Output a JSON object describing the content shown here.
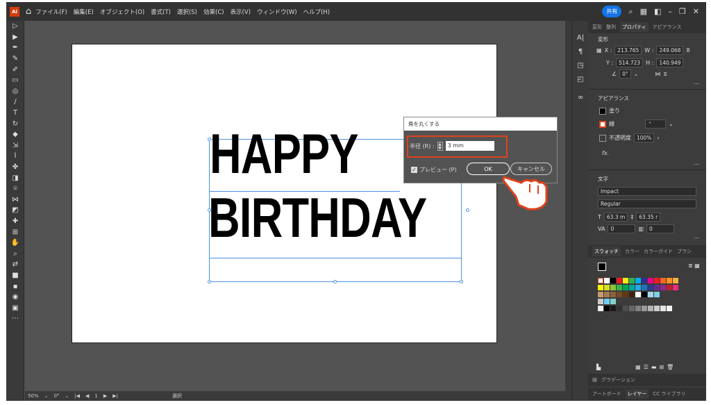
{
  "menubar": {
    "logo": "Ai",
    "items": [
      "ファイル(F)",
      "編集(E)",
      "オブジェクト(O)",
      "書式(T)",
      "選択(S)",
      "効果(C)",
      "表示(V)",
      "ウィンドウ(W)",
      "ヘルプ(H)"
    ],
    "share": "共有"
  },
  "artboard": {
    "line1": "HAPPY",
    "line2": "BIRTHDAY"
  },
  "dialog": {
    "title": "角を丸くする",
    "radius_label": "半径 (R) :",
    "radius_value": "3 mm",
    "preview_label": "プレビュー (P)",
    "ok": "OK",
    "cancel": "キャンセル"
  },
  "statusbar": {
    "zoom": "50%",
    "rotation": "0°",
    "page": "1",
    "mode": "選択"
  },
  "panel": {
    "tabs": [
      "変形",
      "整列",
      "プロパティ",
      "アピアランス"
    ],
    "transform": {
      "title": "変形",
      "x_label": "X :",
      "x": "213.765",
      "w_label": "W :",
      "w": "249.068",
      "y_label": "Y :",
      "y": "514.723",
      "h_label": "H :",
      "h": "140.949",
      "angle": "0°"
    },
    "appearance": {
      "title": "アピアランス",
      "fill": "塗り",
      "stroke": "線",
      "opacity_label": "不透明度",
      "opacity": "100%",
      "fx": "fx."
    },
    "type": {
      "title": "文字",
      "font": "Impact",
      "style": "Regular",
      "size": "63.3 m",
      "leading": "63.35 r",
      "tracking": "0",
      "kerning": "0"
    },
    "swatch_tabs": [
      "スウォッチ",
      "カラー",
      "カラーガイド",
      "ブラシ"
    ],
    "bottom_tabs": [
      "線",
      "グラデーション"
    ],
    "bottom_tabs2": [
      "アートボード",
      "レイヤー",
      "CC ライブラリ"
    ]
  }
}
